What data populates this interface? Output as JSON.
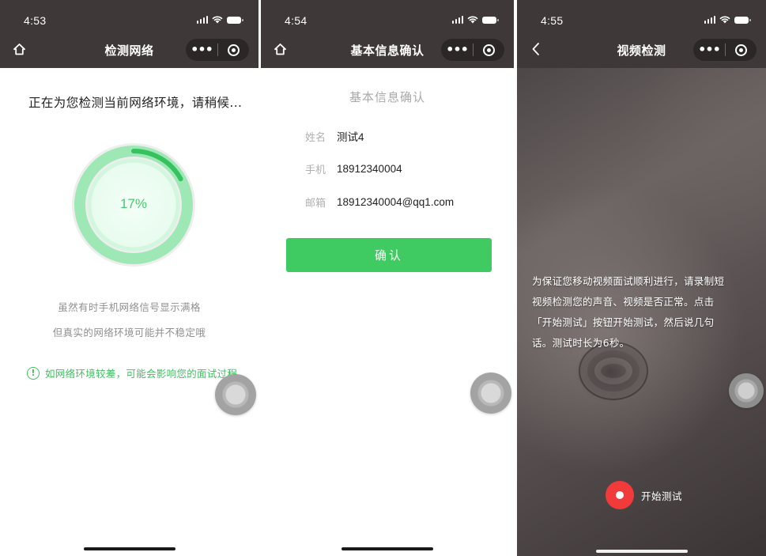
{
  "screens": [
    {
      "time": "4:53",
      "nav_title": "检测网络",
      "left_icon": "home-icon",
      "heading": "正在为您检测当前网络环境，请稍候...",
      "progress_label": "17%",
      "progress_value": 17,
      "tips": [
        "虽然有时手机网络信号显示满格",
        "但真实的网络环境可能并不稳定哦"
      ],
      "warning_mark": "!",
      "warning": "如网络环境较差，可能会影响您的面试过程"
    },
    {
      "time": "4:54",
      "nav_title": "基本信息确认",
      "left_icon": "home-icon",
      "section_title": "基本信息确认",
      "fields": [
        {
          "label": "姓名",
          "value": "测试4"
        },
        {
          "label": "手机",
          "value": "18912340004"
        },
        {
          "label": "邮箱",
          "value": "18912340004@qq1.com"
        }
      ],
      "confirm_label": "确认"
    },
    {
      "time": "4:55",
      "nav_title": "视频检测",
      "left_icon": "back-chevron-icon",
      "instruction_lines": [
        "为保证您移动视频面试顺利进行，请录制短",
        "视频检测您的声音、视频是否正常。点击",
        "「开始测试」按钮开始测试，然后说几句",
        "话。测试时长为6秒。"
      ],
      "start_label": "开始测试"
    }
  ],
  "capsule": {
    "more": "•••"
  },
  "colors": {
    "accent": "#3fcb62",
    "record": "#f13b3b",
    "status_bar": "#3e3838"
  }
}
